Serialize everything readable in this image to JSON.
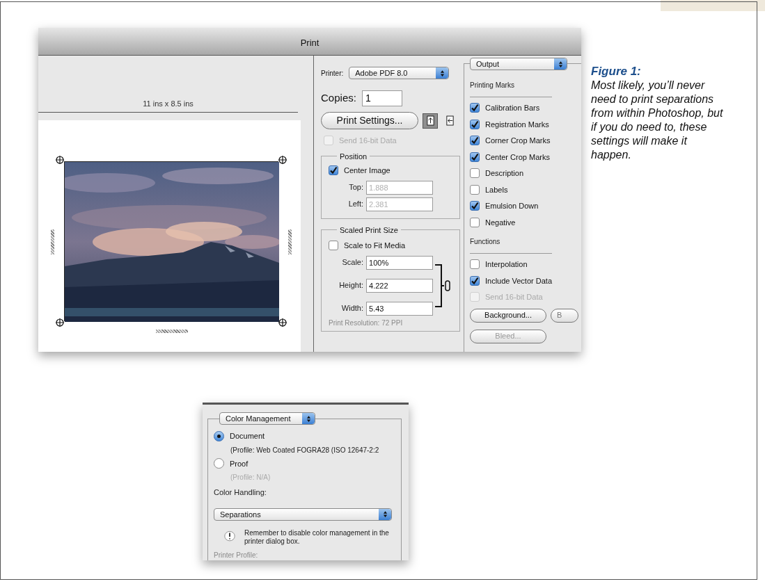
{
  "print_dialog": {
    "title": "Print",
    "paper_size": "11 ins x 8.5 ins",
    "printer": {
      "label": "Printer:",
      "value": "Adobe PDF 8.0"
    },
    "copies": {
      "label": "Copies:",
      "value": "1"
    },
    "print_settings_button": "Print Settings...",
    "orientation": [
      {
        "selected": true
      },
      {
        "selected": false
      }
    ],
    "send_16bit": {
      "label": "Send 16-bit Data",
      "checked": false,
      "disabled": true
    },
    "position": {
      "title": "Position",
      "center_image": {
        "label": "Center Image",
        "checked": true
      },
      "fields": [
        {
          "label": "Top:",
          "value": "1.888",
          "disabled": true
        },
        {
          "label": "Left:",
          "value": "2.381",
          "disabled": true
        }
      ]
    },
    "scaled_print_size": {
      "title": "Scaled Print Size",
      "scale_to_fit": {
        "label": "Scale to Fit Media",
        "checked": false
      },
      "fields": [
        {
          "label": "Scale:",
          "value": "100%",
          "disabled": false
        },
        {
          "label": "Height:",
          "value": "4.222",
          "disabled": false
        },
        {
          "label": "Width:",
          "value": "5.43",
          "disabled": false
        }
      ],
      "print_resolution": "Print Resolution: 72 PPI"
    },
    "output_panel": {
      "menu": "Output",
      "sections": [
        {
          "title": "Printing Marks",
          "options": [
            {
              "label": "Calibration Bars",
              "checked": true,
              "disabled": false
            },
            {
              "label": "Registration Marks",
              "checked": true,
              "disabled": false
            },
            {
              "label": "Corner Crop Marks",
              "checked": true,
              "disabled": false
            },
            {
              "label": "Center Crop Marks",
              "checked": true,
              "disabled": false
            },
            {
              "label": "Description",
              "checked": false,
              "disabled": false
            },
            {
              "label": "Labels",
              "checked": false,
              "disabled": false
            },
            {
              "label": "Emulsion Down",
              "checked": true,
              "disabled": false
            },
            {
              "label": "Negative",
              "checked": false,
              "disabled": false
            }
          ]
        },
        {
          "title": "Functions",
          "options": [
            {
              "label": "Interpolation",
              "checked": false,
              "disabled": false
            },
            {
              "label": "Include Vector Data",
              "checked": true,
              "disabled": false
            },
            {
              "label": "Send 16-bit Data",
              "checked": false,
              "disabled": true
            }
          ]
        }
      ],
      "buttons": [
        "Background...",
        "B",
        "Bleed..."
      ]
    }
  },
  "color_panel": {
    "menu": "Color Management",
    "options": [
      {
        "label": "Document",
        "selected": true,
        "profile": "(Profile: Web Coated FOGRA28 (ISO 12647-2:2"
      },
      {
        "label": "Proof",
        "selected": false,
        "profile": "(Profile: N/A)"
      }
    ],
    "color_handling": {
      "label": "Color Handling:",
      "value": "Separations"
    },
    "note": "Remember to disable color management in the printer dialog box.",
    "printer_profile": "Printer Profile:"
  },
  "caption": {
    "title": "Figure 1:",
    "text": "Most likely, you’ll never need to print separations from within Photoshop, but if you do need to, these settings will make it happen."
  }
}
